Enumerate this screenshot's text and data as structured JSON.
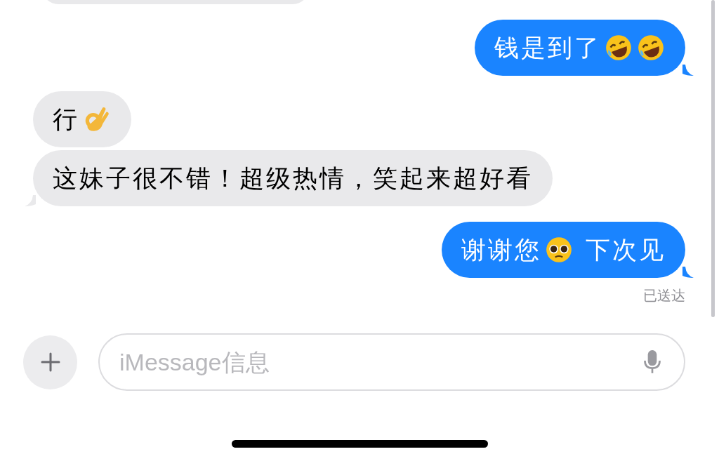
{
  "messages": [
    {
      "kind": "sent",
      "parts": [
        {
          "kind": "text",
          "text": "钱是到了"
        },
        {
          "kind": "laugh"
        },
        {
          "kind": "laugh"
        }
      ],
      "tail": true
    },
    {
      "kind": "received",
      "parts": [
        {
          "kind": "text",
          "text": "行"
        },
        {
          "kind": "ok"
        }
      ],
      "tail": false
    },
    {
      "kind": "received",
      "parts": [
        {
          "kind": "text",
          "text": "这妹子很不错！超级热情，笑起来超好看"
        }
      ],
      "tail": true
    },
    {
      "kind": "sent",
      "parts": [
        {
          "kind": "text",
          "text": "谢谢您"
        },
        {
          "kind": "pleading"
        },
        {
          "kind": "text",
          "text": " 下次见"
        }
      ],
      "tail": true
    }
  ],
  "delivery_status": "已送达",
  "composer": {
    "placeholder": "iMessage信息"
  }
}
